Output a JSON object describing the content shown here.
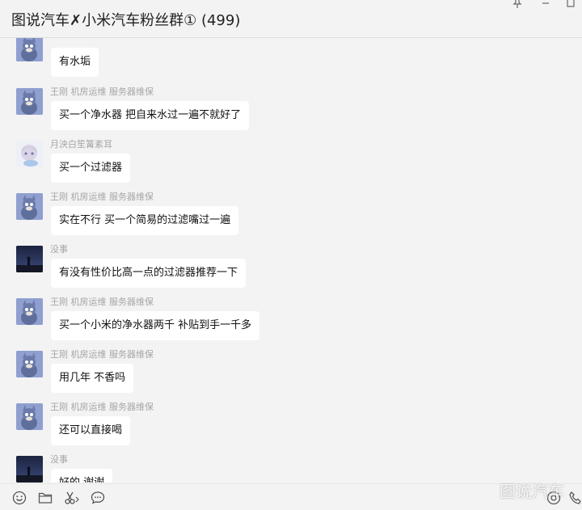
{
  "window": {
    "title": "图说汽车✗小米汽车粉丝群① (499)"
  },
  "messages": [
    {
      "sender": "",
      "avatar": "cat-avatar",
      "text": "有水垢"
    },
    {
      "sender": "王刚 机房运维 服务器维保",
      "avatar": "cat-avatar",
      "text": "买一个净水器  把自来水过一遍不就好了"
    },
    {
      "sender": "月泱白笙篝紊耳",
      "avatar": "anime-girl-avatar",
      "text": "买一个过滤器"
    },
    {
      "sender": "王刚 机房运维 服务器维保",
      "avatar": "cat-avatar",
      "text": "实在不行  买一个简易的过滤嘴过一遍"
    },
    {
      "sender": "没事",
      "avatar": "night-sky-avatar",
      "text": "有没有性价比高一点的过滤器推荐一下"
    },
    {
      "sender": "王刚 机房运维 服务器维保",
      "avatar": "cat-avatar",
      "text": "买一个小米的净水器两千  补贴到手一千多"
    },
    {
      "sender": "王刚 机房运维 服务器维保",
      "avatar": "cat-avatar",
      "text": "用几年  不香吗"
    },
    {
      "sender": "王刚 机房运维 服务器维保",
      "avatar": "cat-avatar",
      "text": "还可以直接喝"
    },
    {
      "sender": "没事",
      "avatar": "night-sky-avatar",
      "text": "好的  谢谢"
    }
  ],
  "toolbar": {
    "tools": [
      "emoji-icon",
      "folder-icon",
      "scissors-icon",
      "chat-bubble-icon",
      "history-icon",
      "phone-icon"
    ]
  },
  "watermark": "图说汽车"
}
